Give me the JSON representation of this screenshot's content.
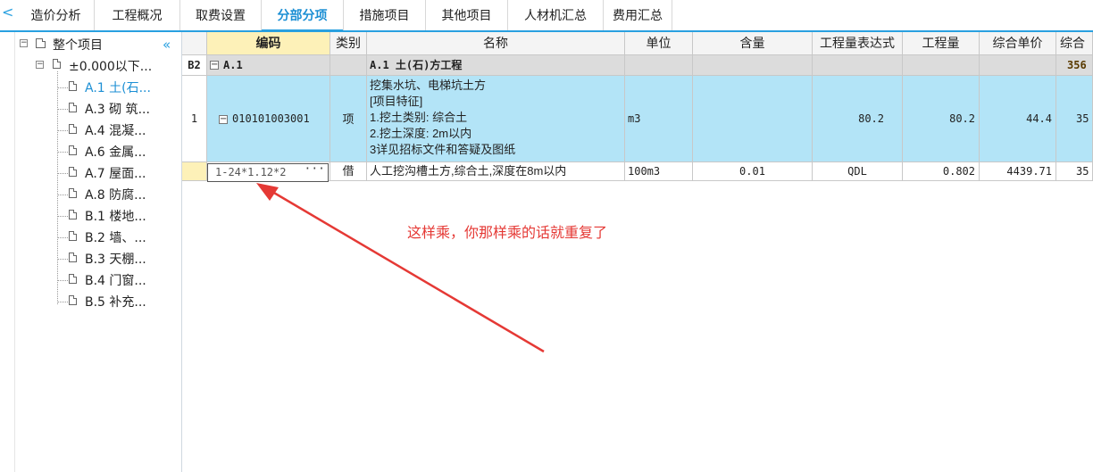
{
  "tabs": [
    {
      "label": "造价分析",
      "active": false
    },
    {
      "label": "工程概况",
      "active": false
    },
    {
      "label": "取费设置",
      "active": false
    },
    {
      "label": "分部分项",
      "active": true
    },
    {
      "label": "措施项目",
      "active": false
    },
    {
      "label": "其他项目",
      "active": false
    },
    {
      "label": "人材机汇总",
      "active": false
    },
    {
      "label": "费用汇总",
      "active": false
    }
  ],
  "tree": {
    "root": "整个项目",
    "level1": "±0.000以下...",
    "items": [
      {
        "label": "A.1 土(石...",
        "selected": true
      },
      {
        "label": "A.3 砌 筑...",
        "selected": false
      },
      {
        "label": "A.4 混凝...",
        "selected": false
      },
      {
        "label": "A.6 金属...",
        "selected": false
      },
      {
        "label": "A.7 屋面...",
        "selected": false
      },
      {
        "label": "A.8 防腐...",
        "selected": false
      },
      {
        "label": "B.1 楼地...",
        "selected": false
      },
      {
        "label": "B.2 墙、...",
        "selected": false
      },
      {
        "label": "B.3 天棚...",
        "selected": false
      },
      {
        "label": "B.4 门窗...",
        "selected": false
      },
      {
        "label": "B.5 补充...",
        "selected": false
      }
    ]
  },
  "grid": {
    "headers": {
      "code": "编码",
      "type": "类别",
      "name": "名称",
      "unit": "单位",
      "content": "含量",
      "expr": "工程量表达式",
      "qty": "工程量",
      "price": "综合单价",
      "total": "综合"
    },
    "row_b2": {
      "rownum": "B2",
      "code": "A.1",
      "name": "A.1  土(石)方工程",
      "total": "356"
    },
    "row_1": {
      "rownum": "1",
      "code": "010101003001",
      "type": "项",
      "name_lines": [
        "挖集水坑、电梯坑土方",
        "[项目特征]",
        "1.挖土类别: 综合土",
        "2.挖土深度: 2m以内",
        "3详见招标文件和答疑及图纸"
      ],
      "unit": "m3",
      "expr": "80.2",
      "qty": "80.2",
      "price": "44.4",
      "total": "35"
    },
    "row_2": {
      "code_edit": "1-24*1.12*2",
      "edit_btn": "···",
      "type": "借",
      "name": "人工挖沟槽土方,综合土,深度在8m以内",
      "unit": "100m3",
      "content": "0.01",
      "expr": "QDL",
      "qty": "0.802",
      "price": "4439.71",
      "total": "35"
    }
  },
  "annotation": {
    "text": "这样乘，你那样乘的话就重复了",
    "color": "#e53935"
  },
  "colors": {
    "accent": "#29a0e0",
    "selected_row": "#b3e4f7",
    "header_highlight": "#fdf1b8",
    "group_row": "#dcdcdc"
  }
}
